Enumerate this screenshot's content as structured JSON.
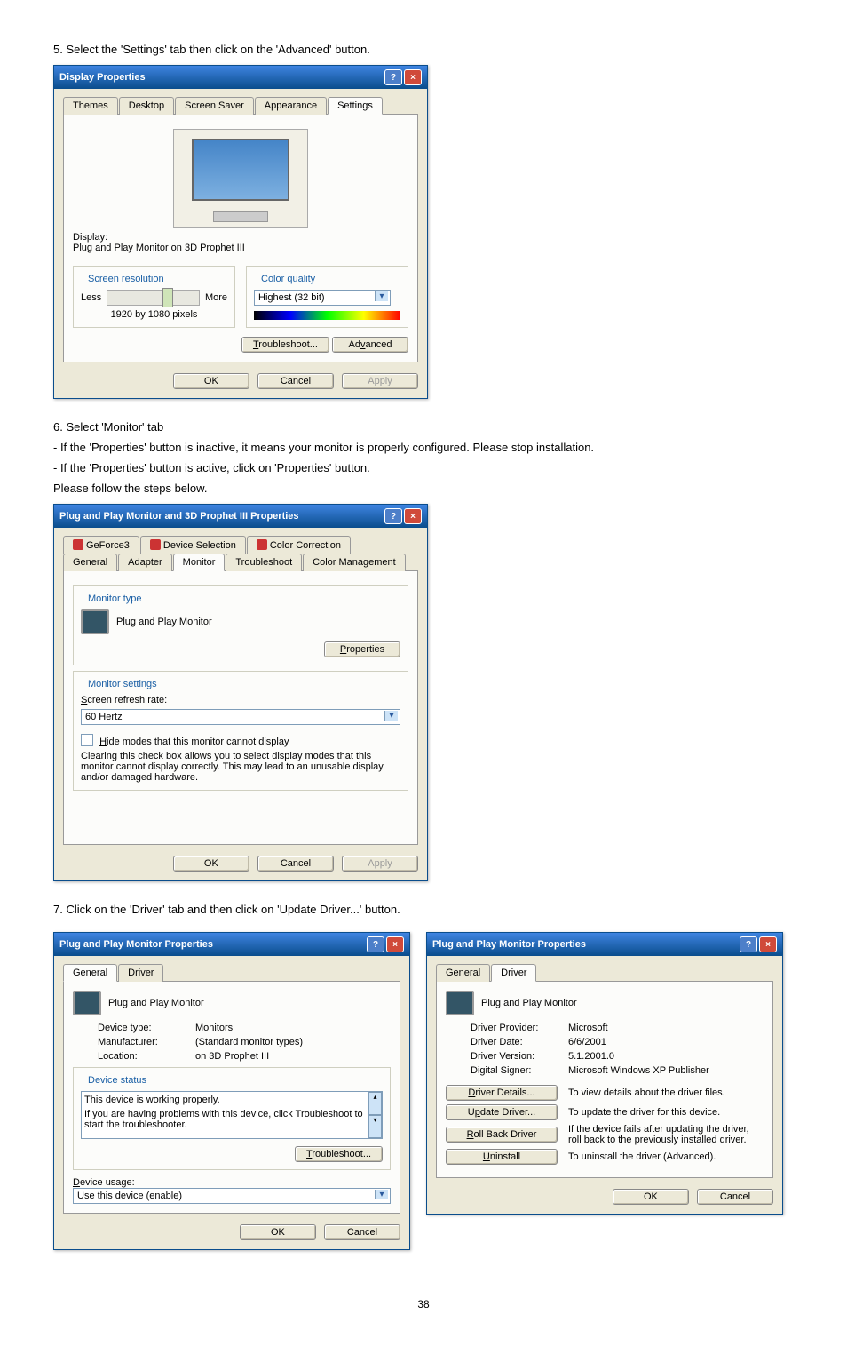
{
  "step5_text": "5. Select the 'Settings' tab then click on the 'Advanced' button.",
  "step6_heading": "6. Select 'Monitor' tab",
  "step6_line1": "- If the 'Properties' button is inactive, it means your monitor is properly configured. Please stop installation.",
  "step6_line2": "- If the 'Properties' button is active, click on 'Properties' button.",
  "step6_line3": "Please follow the steps below.",
  "step7_text": "7. Click on the 'Driver' tab and then click on 'Update Driver...' button.",
  "page_number": "38",
  "display_props": {
    "title": "Display Properties",
    "tabs": [
      "Themes",
      "Desktop",
      "Screen Saver",
      "Appearance",
      "Settings"
    ],
    "display_label": "Display:",
    "display_value": "Plug and Play Monitor on 3D Prophet III",
    "screen_res_legend": "Screen resolution",
    "less": "Less",
    "more": "More",
    "res_value": "1920   by 1080 pixels",
    "color_legend": "Color quality",
    "color_value": "Highest (32 bit)",
    "troubleshoot": "Troubleshoot...",
    "advanced": "Advanced",
    "ok": "OK",
    "cancel": "Cancel",
    "apply": "Apply"
  },
  "monitor_props": {
    "title": "Plug and Play Monitor and 3D Prophet III Properties",
    "tabs_row1": [
      "GeForce3",
      "Device Selection",
      "Color Correction"
    ],
    "tabs_row2": [
      "General",
      "Adapter",
      "Monitor",
      "Troubleshoot",
      "Color Management"
    ],
    "monitor_type_legend": "Monitor type",
    "monitor_name": "Plug and Play Monitor",
    "properties_btn": "Properties",
    "monitor_settings_legend": "Monitor settings",
    "refresh_label": "Screen refresh rate:",
    "refresh_value": "60 Hertz",
    "hide_modes": "Hide modes that this monitor cannot display",
    "hide_text": "Clearing this check box allows you to select display modes that this monitor cannot display correctly. This may lead to an unusable display and/or damaged hardware.",
    "ok": "OK",
    "cancel": "Cancel",
    "apply": "Apply"
  },
  "pnp_general": {
    "title": "Plug and Play Monitor Properties",
    "tabs": [
      "General",
      "Driver"
    ],
    "header": "Plug and Play Monitor",
    "device_type_l": "Device type:",
    "device_type_v": "Monitors",
    "manufacturer_l": "Manufacturer:",
    "manufacturer_v": "(Standard monitor types)",
    "location_l": "Location:",
    "location_v": "on 3D Prophet III",
    "device_status_legend": "Device status",
    "status_text": "This device is working properly.",
    "status_help": "If you are having problems with this device, click Troubleshoot to start the troubleshooter.",
    "troubleshoot": "Troubleshoot...",
    "usage_label": "Device usage:",
    "usage_value": "Use this device (enable)",
    "ok": "OK",
    "cancel": "Cancel"
  },
  "pnp_driver": {
    "title": "Plug and Play Monitor Properties",
    "tabs": [
      "General",
      "Driver"
    ],
    "header": "Plug and Play Monitor",
    "provider_l": "Driver Provider:",
    "provider_v": "Microsoft",
    "date_l": "Driver Date:",
    "date_v": "6/6/2001",
    "version_l": "Driver Version:",
    "version_v": "5.1.2001.0",
    "signer_l": "Digital Signer:",
    "signer_v": "Microsoft Windows XP Publisher",
    "details_btn": "Driver Details...",
    "details_txt": "To view details about the driver files.",
    "update_btn": "Update Driver...",
    "update_txt": "To update the driver for this device.",
    "rollback_btn": "Roll Back Driver",
    "rollback_txt": "If the device fails after updating the driver, roll back to the previously installed driver.",
    "uninstall_btn": "Uninstall",
    "uninstall_txt": "To uninstall the driver (Advanced).",
    "ok": "OK",
    "cancel": "Cancel"
  }
}
